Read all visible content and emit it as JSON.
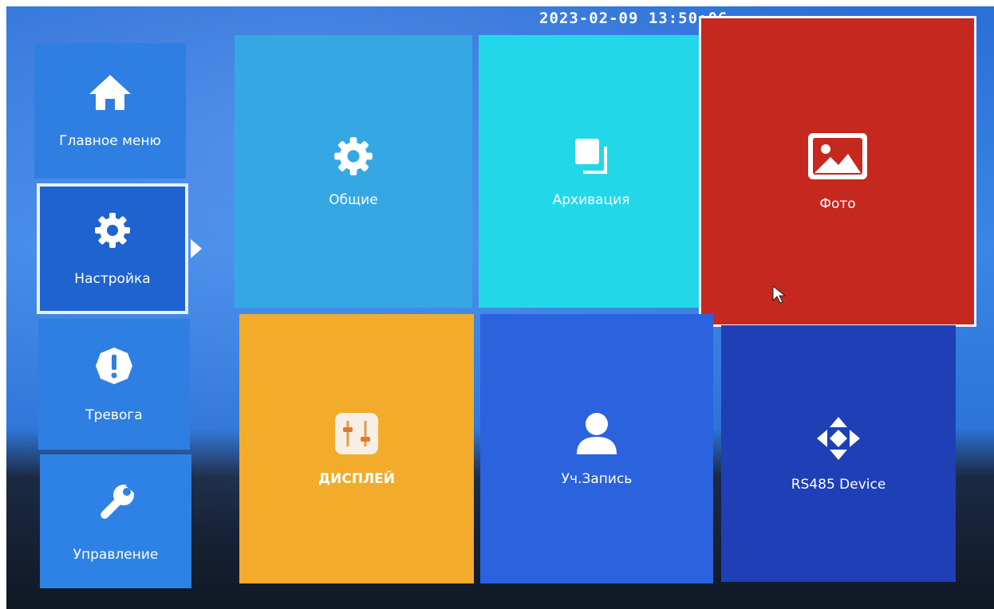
{
  "header": {
    "datetime": "2023-02-09 13:50:06"
  },
  "sidebar": {
    "items": [
      {
        "label": "Главное меню",
        "icon": "home-icon"
      },
      {
        "label": "Настройка",
        "icon": "gear-icon",
        "selected": true
      },
      {
        "label": "Тревога",
        "icon": "alert-icon"
      },
      {
        "label": "Управление",
        "icon": "wrench-icon"
      }
    ]
  },
  "tiles": [
    {
      "label": "Общие",
      "icon": "gear-icon",
      "color": "#35a8e4"
    },
    {
      "label": "Архивация",
      "icon": "copy-icon",
      "color": "#22d8e8"
    },
    {
      "label": "Фото",
      "icon": "image-icon",
      "color": "#c5281e",
      "focused": true
    },
    {
      "label": "ДИСПЛЕЙ",
      "icon": "display-settings-icon",
      "color": "#f2ab2a"
    },
    {
      "label": "Уч.Запись",
      "icon": "user-icon",
      "color": "#2b62de"
    },
    {
      "label": "RS485 Device",
      "icon": "dpad-arrows-icon",
      "color": "#1f3fb6"
    }
  ]
}
